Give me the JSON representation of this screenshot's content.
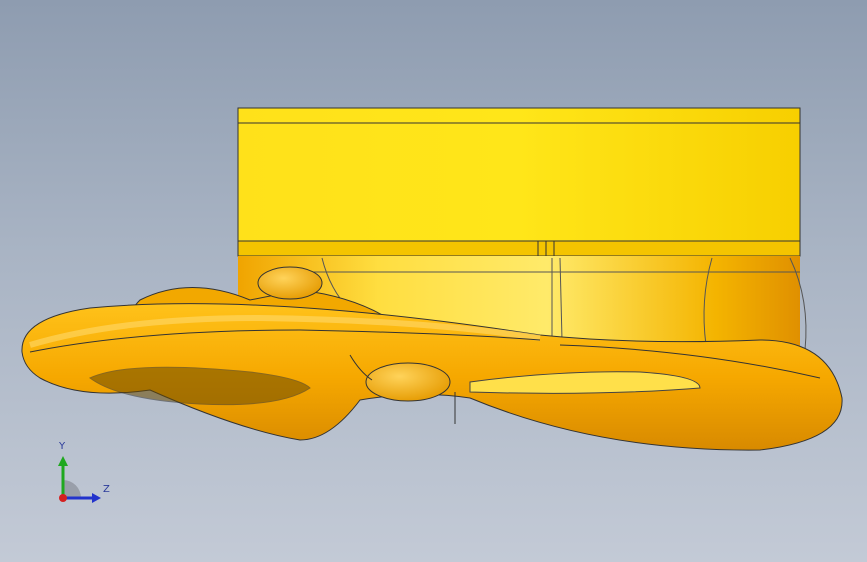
{
  "viewport": {
    "background_top": "#8e9cb0",
    "background_bottom": "#c3cad6",
    "part_color": "#ffd400",
    "shade_color": "#f0a000"
  },
  "model": {
    "parts": [
      "mounting-block",
      "cylindrical-base",
      "lifting-ring"
    ]
  },
  "triad": {
    "y_label": "Y",
    "z_label": "Z",
    "y_color": "#1fa81f",
    "z_color": "#2233cc",
    "x_color": "#d42020"
  }
}
